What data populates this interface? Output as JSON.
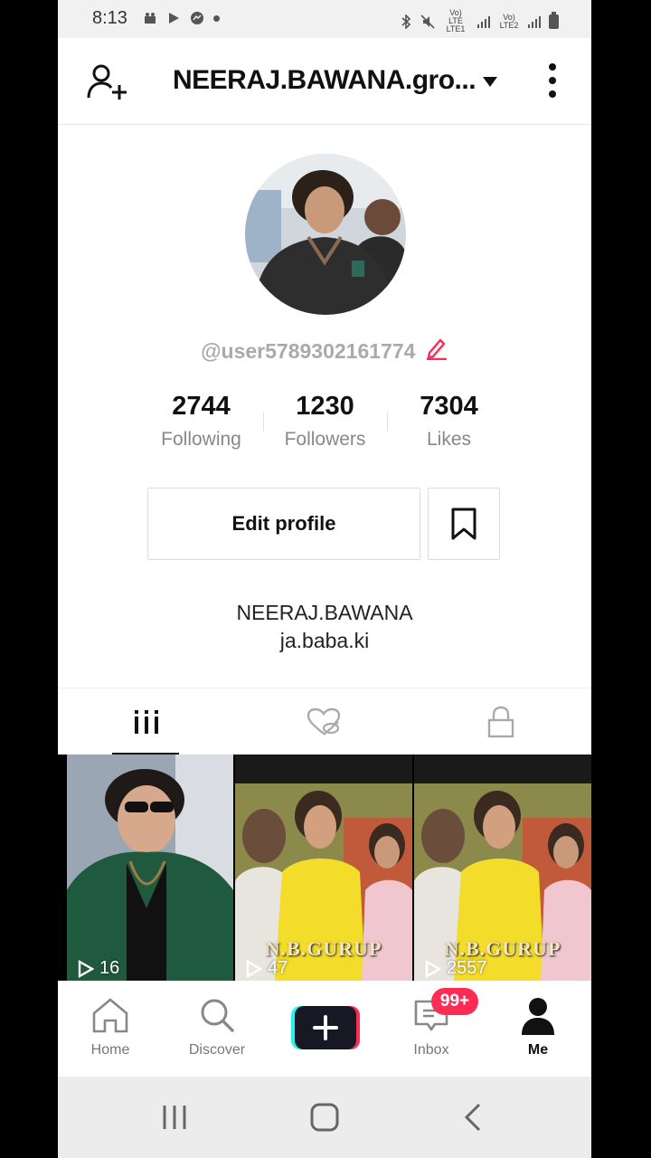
{
  "status_bar": {
    "time": "8:13",
    "sim1_label": "Vo) LTE LTE1",
    "sim2_label": "Vo) LTE2"
  },
  "header": {
    "title": "NEERAJ.BAWANA.gro..."
  },
  "profile": {
    "handle": "@user5789302161774",
    "stats": [
      {
        "value": "2744",
        "label": "Following"
      },
      {
        "value": "1230",
        "label": "Followers"
      },
      {
        "value": "7304",
        "label": "Likes"
      }
    ],
    "edit_label": "Edit profile",
    "bio_line1": "NEERAJ.BAWANA",
    "bio_line2": "ja.baba.ki"
  },
  "tabs": [
    {
      "icon": "grid-icon",
      "active": true
    },
    {
      "icon": "hidden-likes-icon",
      "active": false
    },
    {
      "icon": "lock-icon",
      "active": false
    }
  ],
  "videos": [
    {
      "views": "16",
      "overlay": ""
    },
    {
      "views": "47",
      "overlay": "N.B.GURUP"
    },
    {
      "views": "2557",
      "overlay": "N.B.GURUP"
    }
  ],
  "bottom_nav": {
    "home": "Home",
    "discover": "Discover",
    "inbox": "Inbox",
    "me": "Me",
    "inbox_badge": "99+"
  },
  "colors": {
    "accent": "#fe2c55",
    "cyan": "#25f4ee",
    "text_dark": "#111111",
    "text_muted": "#888888"
  }
}
